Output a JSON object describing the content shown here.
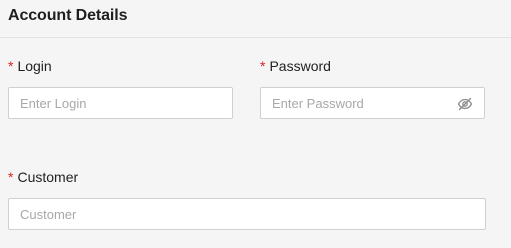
{
  "section": {
    "title": "Account Details"
  },
  "required_marker": "*",
  "fields": {
    "login": {
      "label": "Login",
      "placeholder": "Enter Login",
      "value": ""
    },
    "password": {
      "label": "Password",
      "placeholder": "Enter Password",
      "value": "",
      "toggle_icon": "eye-off-icon"
    },
    "customer": {
      "label": "Customer",
      "placeholder": "Customer",
      "value": ""
    }
  },
  "colors": {
    "required": "#e02020",
    "border": "#d0d0d0",
    "background": "#f5f5f5"
  }
}
